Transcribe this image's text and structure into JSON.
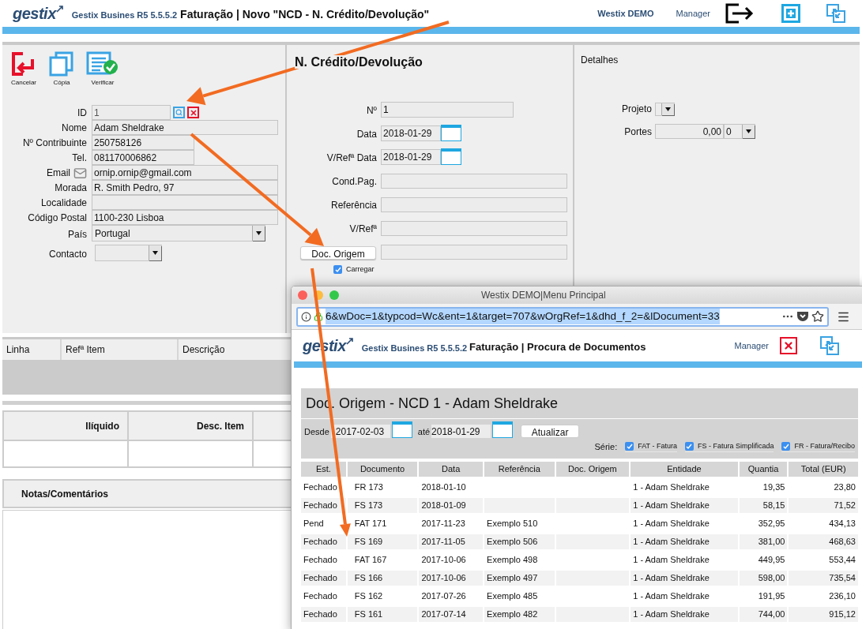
{
  "header": {
    "logo": "gestix",
    "product": "Gestix Busines R5 5.5.5.2",
    "title": "Faturação | Novo \"NCD - N. Crédito/Devolução\"",
    "company": "Westix DEMO",
    "user": "Manager"
  },
  "toolbar": [
    {
      "label": "Cancelar",
      "kind": "cancel"
    },
    {
      "label": "Cópia",
      "kind": "copy"
    },
    {
      "label": "Verificar",
      "kind": "verify"
    }
  ],
  "customer_fields": [
    {
      "label": "ID",
      "value": "1",
      "kind": "id"
    },
    {
      "label": "Nome",
      "value": "Adam Sheldrake",
      "kind": "long"
    },
    {
      "label": "Nº Contribuinte",
      "value": "250758126",
      "kind": "medium"
    },
    {
      "label": "Tel.",
      "value": "081170006862",
      "kind": "medium"
    },
    {
      "label": "Email",
      "value": "ornip.ornip@gmail.com",
      "kind": "email"
    },
    {
      "label": "Morada",
      "value": "R. Smith Pedro, 97",
      "kind": "long"
    },
    {
      "label": "Localidade",
      "kind": "long"
    },
    {
      "label": "Código Postal",
      "value": "1100-230 Lisboa",
      "kind": "long"
    },
    {
      "label": "País",
      "value": "Portugal",
      "kind": "select"
    },
    {
      "label": "Contacto",
      "kind": "combo"
    }
  ],
  "document": {
    "title": "N. Crédito/Devolução",
    "fields": [
      {
        "label": "Nº",
        "value": "1",
        "kind": "medium"
      },
      {
        "label": "Data",
        "value": "2018-01-29",
        "kind": "date"
      },
      {
        "label": "V/Refª Data",
        "value": "2018-01-29",
        "kind": "date"
      },
      {
        "label": "Cond.Pag.",
        "kind": "long"
      },
      {
        "label": "Referência",
        "kind": "long"
      },
      {
        "label": "V/Refª",
        "kind": "long"
      }
    ],
    "origin_button": "Doc. Origem",
    "load_checkbox": {
      "label": "Carregar",
      "checked": true
    }
  },
  "details": {
    "title": "Detalhes",
    "project_label": "Projeto",
    "postage_label": "Portes",
    "postage_value": "0,00",
    "postage_rate": "0"
  },
  "lines_table": {
    "columns": [
      "Linha",
      "Refª Item",
      "Descrição"
    ]
  },
  "totals_table": {
    "columns": [
      "Ilíquido",
      "Desc. Item"
    ]
  },
  "notes": {
    "title": "Notas/Comentários"
  },
  "popup": {
    "window_title": "Westix DEMO|Menu Principal",
    "url": "6&wDoc=1&typcod=Wc&ent=1&target=707&wOrgRef=1&dhd_f_2=&lDocument=33",
    "header": {
      "logo": "gestix",
      "product": "Gestix Busines R5 5.5.5.2",
      "title": "Faturação | Procura de Documentos",
      "user": "Manager"
    },
    "search": {
      "title": "Doc. Origem - NCD 1 - Adam Sheldrake",
      "from_label": "Desde",
      "from": "2017-02-03",
      "to_label": "até",
      "to": "2018-01-29",
      "button": "Atualizar",
      "series_label": "Série:",
      "series": [
        {
          "label": "FAT - Fatura",
          "checked": true
        },
        {
          "label": "FS - Fatura Simplificada",
          "checked": true
        },
        {
          "label": "FR - Fatura/Recibo",
          "checked": true
        }
      ]
    },
    "table": {
      "columns": [
        {
          "label": "Est.",
          "kind": "text"
        },
        {
          "label": "Documento",
          "kind": "text"
        },
        {
          "label": "Data",
          "kind": "text"
        },
        {
          "label": "Referência",
          "kind": "text"
        },
        {
          "label": "Doc. Origem",
          "kind": "text"
        },
        {
          "label": "Entidade",
          "kind": "text"
        },
        {
          "label": "Quantia",
          "kind": "number"
        },
        {
          "label": "Total (EUR)",
          "kind": "number"
        }
      ],
      "rows": [
        [
          "Fechado",
          "FR 173",
          "2018-01-10",
          "",
          "",
          "1 - Adam Sheldrake",
          "19,35",
          "23,80"
        ],
        [
          "Fechado",
          "FS 173",
          "2018-01-09",
          "",
          "",
          "1 - Adam Sheldrake",
          "58,15",
          "71,52"
        ],
        [
          "Pend",
          "FAT 171",
          "2017-11-23",
          "Exemplo 510",
          "",
          "1 - Adam Sheldrake",
          "352,95",
          "434,13"
        ],
        [
          "Fechado",
          "FS 169",
          "2017-11-05",
          "Exemplo 506",
          "",
          "1 - Adam Sheldrake",
          "381,00",
          "468,63"
        ],
        [
          "Fechado",
          "FAT 167",
          "2017-10-06",
          "Exemplo 498",
          "",
          "1 - Adam Sheldrake",
          "449,95",
          "553,44"
        ],
        [
          "Fechado",
          "FS 166",
          "2017-10-06",
          "Exemplo 497",
          "",
          "1 - Adam Sheldrake",
          "598,00",
          "735,54"
        ],
        [
          "Fechado",
          "FS 162",
          "2017-07-26",
          "Exemplo 485",
          "",
          "1 - Adam Sheldrake",
          "191,95",
          "236,10"
        ],
        [
          "Fechado",
          "FS 161",
          "2017-07-14",
          "Exemplo 482",
          "",
          "1 - Adam Sheldrake",
          "744,00",
          "915,12"
        ]
      ]
    }
  }
}
